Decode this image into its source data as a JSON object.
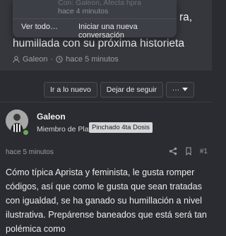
{
  "popup": {
    "meta_line1": "Con: Galeon, Afecta hpra",
    "meta_line2": "hace 4 minutos",
    "see_all": "Ver todo…",
    "new_conversation": "Iniciar una nueva conversación"
  },
  "thread": {
    "title_fragment": "ra,",
    "title_line2": "humillada con su próxima historieta",
    "author": "Galeon",
    "time": "hace 5 minutos"
  },
  "buttons": {
    "goto_new": "Ir a lo nuevo",
    "unfollow": "Dejar de seguir",
    "more": "···"
  },
  "post": {
    "username": "Galeon",
    "rank": "Miembro de Plata",
    "badge": "Pinchado 4ta Dosis",
    "time": "hace 5 minutos",
    "number": "#1",
    "body": "Cómo típica Aprista y feminista, le gusta romper códigos, así que como le gusta que sean tratadas con igualdad, se ha ganado su humillación a nivel ilustrativa. Prepárense baneados que está será tan polémica como"
  },
  "colors": {
    "background": "#2a2c31",
    "card": "#35373d",
    "online": "#6aa84f"
  }
}
